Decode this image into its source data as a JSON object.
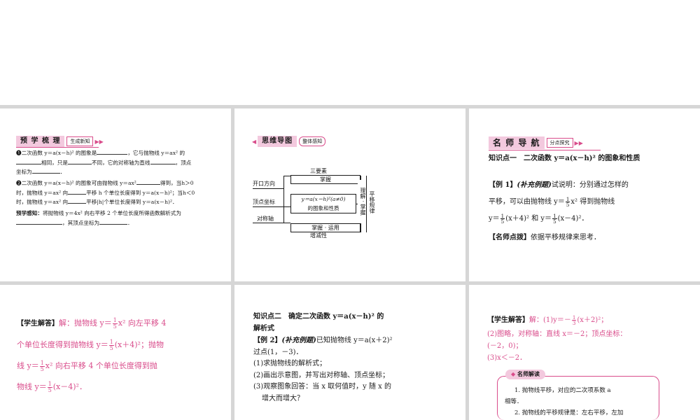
{
  "panel1": {
    "header": {
      "title": "预 学 梳 理",
      "sub": "生成新知"
    },
    "item1": {
      "num": "❶",
      "t1": "二次函数 y＝a(x－h)² 的图象是",
      "t2": "，它与抛物线 y＝ax² 的",
      "t3": "相同，只是",
      "t4": "不同，它的对称轴为直线",
      "t5": "，顶点",
      "t6": "坐标为",
      "t7": "．"
    },
    "item2": {
      "num": "❷",
      "t1": "二次函数 y＝a(x－h)² 的图象可由抛物线 y＝ax²",
      "t2": "得到，当h＞0",
      "t3": "时，抛物线 y＝ax² 向",
      "t4": "平移 h 个单位长度得到 y＝a(x－h)²；当h＜0",
      "t5": "时，抛物线 y＝ax² 向",
      "t6": "平移|h|个单位长度得到 y＝a(x－h)²．"
    },
    "preview": {
      "label": "预学感知：",
      "t1": "将抛物线 y＝4x² 向右平移 2 个单位长度所得函数解析式为",
      "t2": "，其顶点坐标为",
      "t3": "．"
    }
  },
  "panel2": {
    "header": {
      "title": "思维导图",
      "sub": "整体感知"
    },
    "center1": "y＝a(x－h)²(a≠0)",
    "center2": "的图象和性质",
    "left": [
      "开口方向",
      "顶点坐标",
      "对称轴"
    ],
    "top_label": "三要素",
    "top_box": "掌握",
    "bottom_box": "掌握 · 运用",
    "bottom_label": "增减性",
    "vert1": "理解 · 掌握",
    "vert2": "平移规律"
  },
  "panel3": {
    "header": {
      "title": "名 师 导 航",
      "sub": "分点探究"
    },
    "heading": "知识点一　二次函数 y＝a(x－h)² 的图象和性质",
    "example_label": "【例 1】",
    "example_tag": "(补充例题)",
    "e1": "试说明：分别通过怎样的",
    "e2a": "平移，可以由抛物线 y＝",
    "e2b": "x² 得到抛物线",
    "e3a": "y＝",
    "e3b": "(x＋4)² 和 y＝",
    "e3c": "(x－4)²．",
    "frac_num": "1",
    "frac_den": "5",
    "tip_label": "【名师点拨】",
    "tip": "依据平移规律来思考．"
  },
  "panel4": {
    "label": "【学生解答】",
    "l1a": "解：抛物线 y＝",
    "l1b": "x² 向左平移 4",
    "l2a": "个单位长度得到抛物线 y＝",
    "l2b": "(x＋4)²；抛物",
    "l3a": "线 y＝",
    "l3b": "x² 向右平移 4 个单位长度得到抛",
    "l4a": "物线 y＝",
    "l4b": "(x－4)²．",
    "frac_num": "1",
    "frac_den": "5"
  },
  "panel5": {
    "heading1": "知识点二　确定二次函数 y＝a(x－h)² 的",
    "heading2": "解析式",
    "example_label": "【例 2】",
    "example_tag": "(补充例题)",
    "e1": "已知抛物线 y＝a(x＋2)²",
    "e2": "过点(1，－3)．",
    "q1": "(1)求抛物线的解析式；",
    "q2": "(2)画出示意图，并写出对称轴、顶点坐标；",
    "q3": "(3)观察图象回答：当 x 取何值时，y 随 x 的",
    "q4": "增大而增大？"
  },
  "panel6": {
    "label": "【学生解答】",
    "a1a": "解：(1)y＝－",
    "a1b": "(x＋2)²；",
    "frac_num": "1",
    "frac_den": "3",
    "a2": "(2)图略，对称轴：直线 x＝－2；顶点坐标：",
    "a3": "(－2，0)；",
    "a4": "(3)x＜－2．",
    "teacher_tag": "名师解读",
    "t1": "1. 抛物线平移，对应的二次项系数 a",
    "t2": "相等．",
    "t3": "2. 抛物线的平移规律是：左右平移，左加"
  },
  "colors": {
    "accent": "#d94c8b",
    "tag_bg": "#f3c9de",
    "divider": "#d6d6d6"
  }
}
